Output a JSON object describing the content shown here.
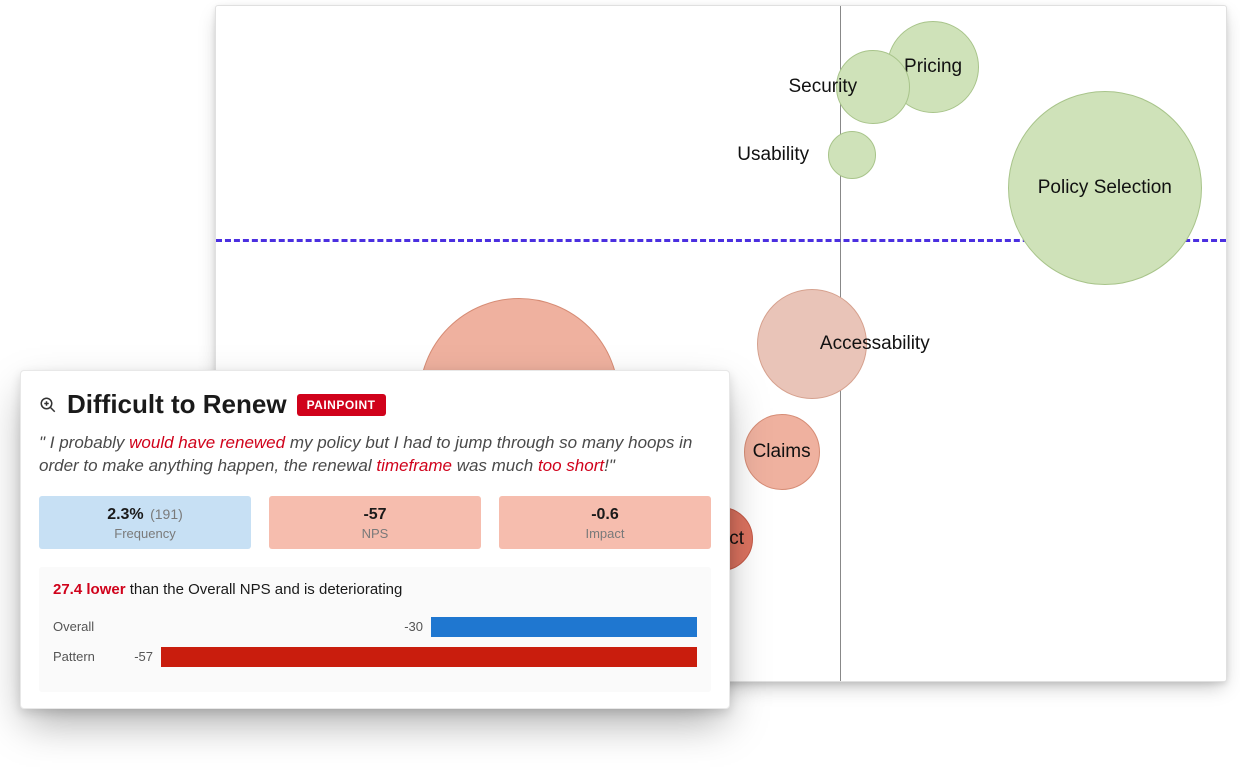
{
  "chart_data": {
    "type": "bubble",
    "title": "",
    "xaxis": {
      "label": "",
      "center": 0.618,
      "visible_line": true
    },
    "yaxis": {
      "label": "",
      "center": 0.345,
      "visible_line": "dashed"
    },
    "note": "x/y are relative positions within the visible plot panel (0-1), size is bubble diameter in px; color encodes sentiment (green positive, red negative, deeper red = worse).",
    "bubbles": [
      {
        "name": "Policy Selection",
        "x": 0.88,
        "y": 0.27,
        "size": 194,
        "color": "green"
      },
      {
        "name": "Pricing",
        "x": 0.71,
        "y": 0.09,
        "size": 92,
        "color": "green"
      },
      {
        "name": "Security",
        "x": 0.65,
        "y": 0.12,
        "size": 74,
        "color": "green"
      },
      {
        "name": "Usability",
        "x": 0.63,
        "y": 0.22,
        "size": 48,
        "color": "green",
        "label_position": "left-outside"
      },
      {
        "name": "Accessability",
        "x": 0.59,
        "y": 0.5,
        "size": 110,
        "color": "red2",
        "label_position": "right-outside"
      },
      {
        "name": "Claims",
        "x": 0.56,
        "y": 0.66,
        "size": 76,
        "color": "red1"
      },
      {
        "name": "Difficult to Renew",
        "x": 0.3,
        "y": 0.58,
        "size": 200,
        "color": "red1",
        "label_hidden": true
      },
      {
        "name": "Contact",
        "x": 0.5,
        "y": 0.79,
        "size": 64,
        "color": "red3",
        "label_partial": "ct"
      }
    ]
  },
  "popover": {
    "title": "Difficult to Renew",
    "badge": "PAINPOINT",
    "icon_name": "magnify-icon",
    "quote": {
      "open": "\" ",
      "p1": "I probably ",
      "hl1": "would have renewed",
      "p2": " my policy but I had to jump through so many hoops in order to make anything happen, the renewal ",
      "hl2": "timeframe",
      "p3": " was much ",
      "hl3": "too short",
      "close": "!\""
    },
    "metrics": {
      "frequency": {
        "value": "2.3%",
        "count": "(191)",
        "label": "Frequency"
      },
      "nps": {
        "value": "-57",
        "label": "NPS"
      },
      "impact": {
        "value": "-0.6",
        "label": "Impact"
      }
    },
    "compare": {
      "delta": "27.4 lower",
      "rest": " than the Overall NPS and is deteriorating",
      "rows": [
        {
          "name": "Overall",
          "value": -30,
          "color": "blue"
        },
        {
          "name": "Pattern",
          "value": -57,
          "color": "red"
        }
      ],
      "axis_min": -57,
      "axis_max": 0
    }
  }
}
